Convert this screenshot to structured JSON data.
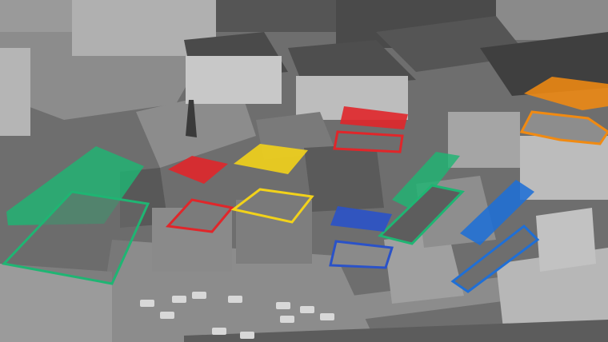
{
  "image": {
    "description_kind": "aerial-photo",
    "style": "grayscale with colored building overlays",
    "colors": {
      "green": "#1fb573",
      "red": "#e0262a",
      "yellow": "#f2d21a",
      "blue": "#2a52c8",
      "sky_blue": "#1f6fd6",
      "orange": "#f08a12",
      "ground": "#6e6e6e",
      "roof_dark": "#4a4a4a",
      "roof_light": "#a8a8a8",
      "road": "#8c8c8c",
      "car": "#d8d8d8"
    },
    "highlight_groups": [
      {
        "color": "green",
        "filled_count": 2,
        "outlined_count": 2
      },
      {
        "color": "red",
        "filled_count": 2,
        "outlined_count": 2
      },
      {
        "color": "yellow",
        "filled_count": 1,
        "outlined_count": 1
      },
      {
        "color": "blue",
        "filled_count": 2,
        "outlined_count": 2
      },
      {
        "color": "orange",
        "filled_count": 1,
        "outlined_count": 1
      }
    ]
  }
}
